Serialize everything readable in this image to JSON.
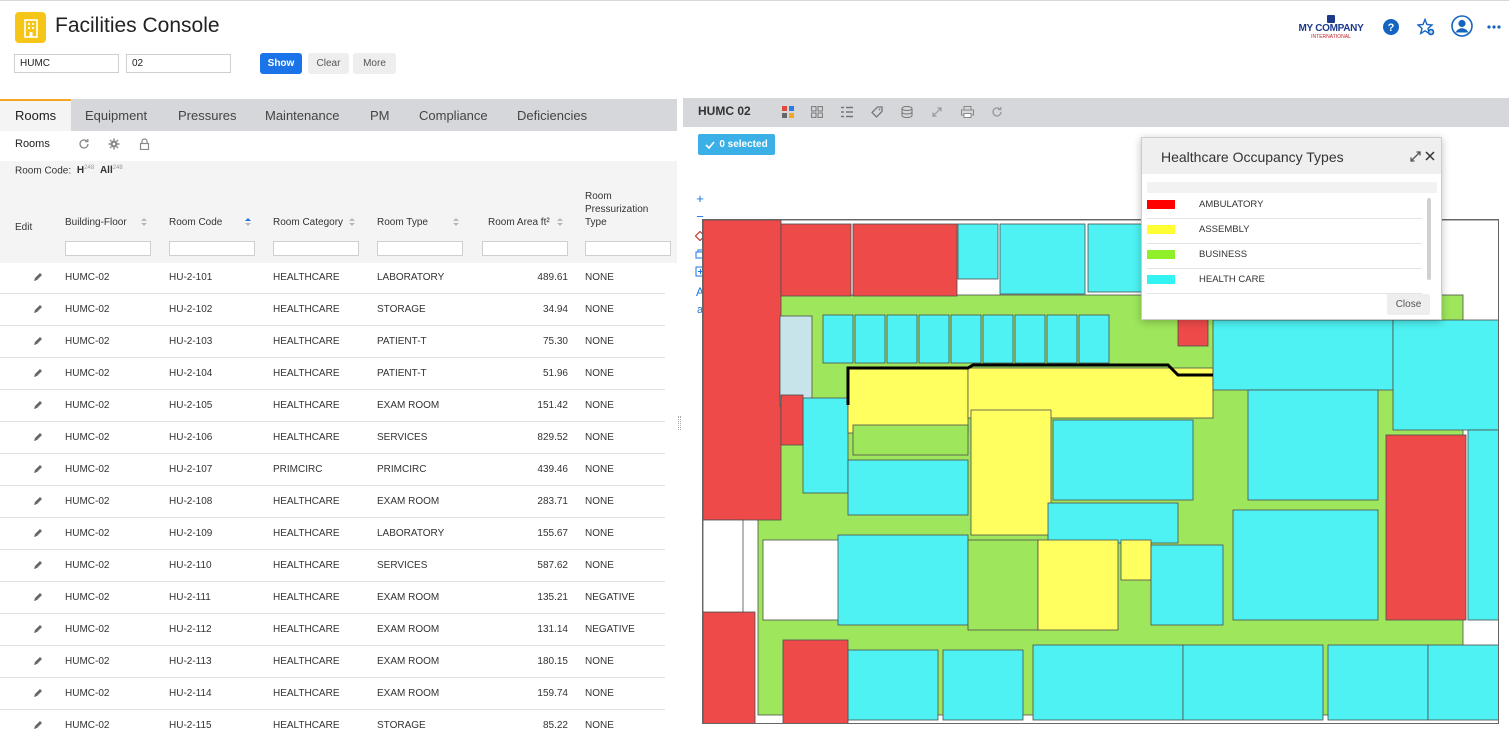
{
  "header": {
    "title": "Facilities Console",
    "logo_line1": "MY COMPANY",
    "logo_line2": "INTERNATIONAL"
  },
  "filters": {
    "building": "HUMC",
    "floor": "02",
    "show_label": "Show",
    "clear_label": "Clear",
    "more_label": "More"
  },
  "tabs": [
    "Rooms",
    "Equipment",
    "Pressures",
    "Maintenance",
    "PM",
    "Compliance",
    "Deficiencies"
  ],
  "rooms_panel": {
    "title": "Rooms",
    "room_code_label": "Room Code:",
    "filter_h": "H",
    "filter_h_count": "248",
    "filter_all": "All",
    "filter_all_count": "248"
  },
  "table": {
    "columns": [
      "Edit",
      "Building-Floor",
      "Room Code",
      "Room Category",
      "Room Type",
      "Room Area ft²",
      "Room Pressurization Type"
    ],
    "rows": [
      [
        "HUMC-02",
        "HU-2-101",
        "HEALTHCARE",
        "LABORATORY",
        "489.61",
        "NONE"
      ],
      [
        "HUMC-02",
        "HU-2-102",
        "HEALTHCARE",
        "STORAGE",
        "34.94",
        "NONE"
      ],
      [
        "HUMC-02",
        "HU-2-103",
        "HEALTHCARE",
        "PATIENT-T",
        "75.30",
        "NONE"
      ],
      [
        "HUMC-02",
        "HU-2-104",
        "HEALTHCARE",
        "PATIENT-T",
        "51.96",
        "NONE"
      ],
      [
        "HUMC-02",
        "HU-2-105",
        "HEALTHCARE",
        "EXAM ROOM",
        "151.42",
        "NONE"
      ],
      [
        "HUMC-02",
        "HU-2-106",
        "HEALTHCARE",
        "SERVICES",
        "829.52",
        "NONE"
      ],
      [
        "HUMC-02",
        "HU-2-107",
        "PRIMCIRC",
        "PRIMCIRC",
        "439.46",
        "NONE"
      ],
      [
        "HUMC-02",
        "HU-2-108",
        "HEALTHCARE",
        "EXAM ROOM",
        "283.71",
        "NONE"
      ],
      [
        "HUMC-02",
        "HU-2-109",
        "HEALTHCARE",
        "LABORATORY",
        "155.67",
        "NONE"
      ],
      [
        "HUMC-02",
        "HU-2-110",
        "HEALTHCARE",
        "SERVICES",
        "587.62",
        "NONE"
      ],
      [
        "HUMC-02",
        "HU-2-111",
        "HEALTHCARE",
        "EXAM ROOM",
        "135.21",
        "NEGATIVE"
      ],
      [
        "HUMC-02",
        "HU-2-112",
        "HEALTHCARE",
        "EXAM ROOM",
        "131.14",
        "NEGATIVE"
      ],
      [
        "HUMC-02",
        "HU-2-113",
        "HEALTHCARE",
        "EXAM ROOM",
        "180.15",
        "NONE"
      ],
      [
        "HUMC-02",
        "HU-2-114",
        "HEALTHCARE",
        "EXAM ROOM",
        "159.74",
        "NONE"
      ],
      [
        "HUMC-02",
        "HU-2-115",
        "HEALTHCARE",
        "STORAGE",
        "85.22",
        "NONE"
      ]
    ]
  },
  "drawing": {
    "title": "HUMC 02",
    "selected_label": "0 selected"
  },
  "legend": {
    "title": "Healthcare Occupancy Types",
    "items": [
      {
        "name": "AMBULATORY",
        "color": "#ff0000"
      },
      {
        "name": "ASSEMBLY",
        "color": "#ffff33"
      },
      {
        "name": "BUSINESS",
        "color": "#8ff02a"
      },
      {
        "name": "HEALTH CARE",
        "color": "#33f2f2"
      }
    ],
    "close_label": "Close"
  },
  "colors": {
    "accent": "#1a73e8",
    "tab_active": "#f5a623",
    "badge": "#3ab0e6",
    "ambulatory": "#ef4a4a",
    "assembly": "#ffff60",
    "business": "#9ee65b",
    "health_care": "#4ef2f2"
  }
}
